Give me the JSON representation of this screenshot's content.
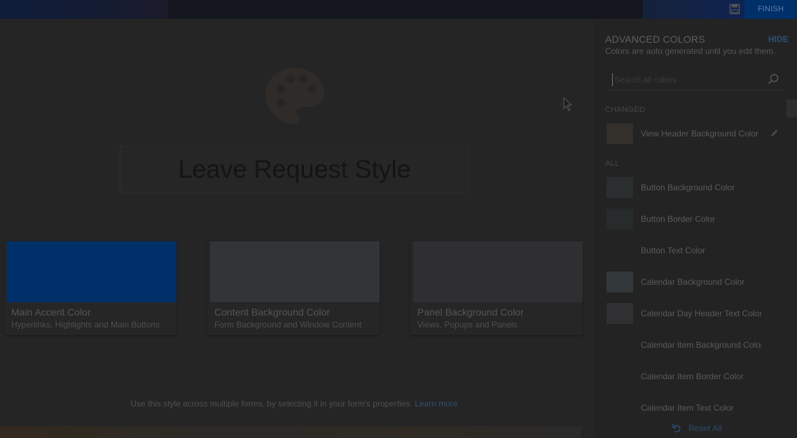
{
  "topbar": {
    "finish_label": "FINISH",
    "save_icon": "save-icon"
  },
  "main": {
    "style_name": "Leave Request Style",
    "cards": [
      {
        "title": "Main Accent Color",
        "subtitle": "Hyperlinks, Highlights and Main Buttons",
        "color": "#00306a"
      },
      {
        "title": "Content Background Color",
        "subtitle": "Form Background and Window Content",
        "color": "#323538"
      },
      {
        "title": "Panel Background Color",
        "subtitle": "Views, Popups and Panels",
        "color": "#2f2f31"
      }
    ],
    "footer_text": "Use this style across multiple forms, by selecting it in your form's properties.",
    "footer_link": "Learn more"
  },
  "panel": {
    "title": "ADVANCED COLORS",
    "hide_label": "HIDE",
    "subtitle": "Colors are auto generated until you edit them.",
    "search_placeholder": "Search all colors",
    "changed_label": "CHANGED",
    "changed_items": [
      {
        "label": "View Header Background Color",
        "color": "#332f2a"
      }
    ],
    "all_label": "ALL",
    "all_items": [
      {
        "label": "Button Background Color",
        "color": "#2b2e2e"
      },
      {
        "label": "Button Border Color",
        "color": "#282b2c"
      },
      {
        "label": "Button Text Color",
        "color": "#232323"
      },
      {
        "label": "Calendar Background Color",
        "color": "#33383b"
      },
      {
        "label": "Calendar Day Header Text Color",
        "color": "#303032"
      },
      {
        "label": "Calendar Item Background Color",
        "color": "#232323"
      },
      {
        "label": "Calendar Item Border Color",
        "color": "#232323"
      },
      {
        "label": "Calendar Item Text Color",
        "color": "#232323"
      }
    ],
    "reset_label": "Reset All"
  }
}
